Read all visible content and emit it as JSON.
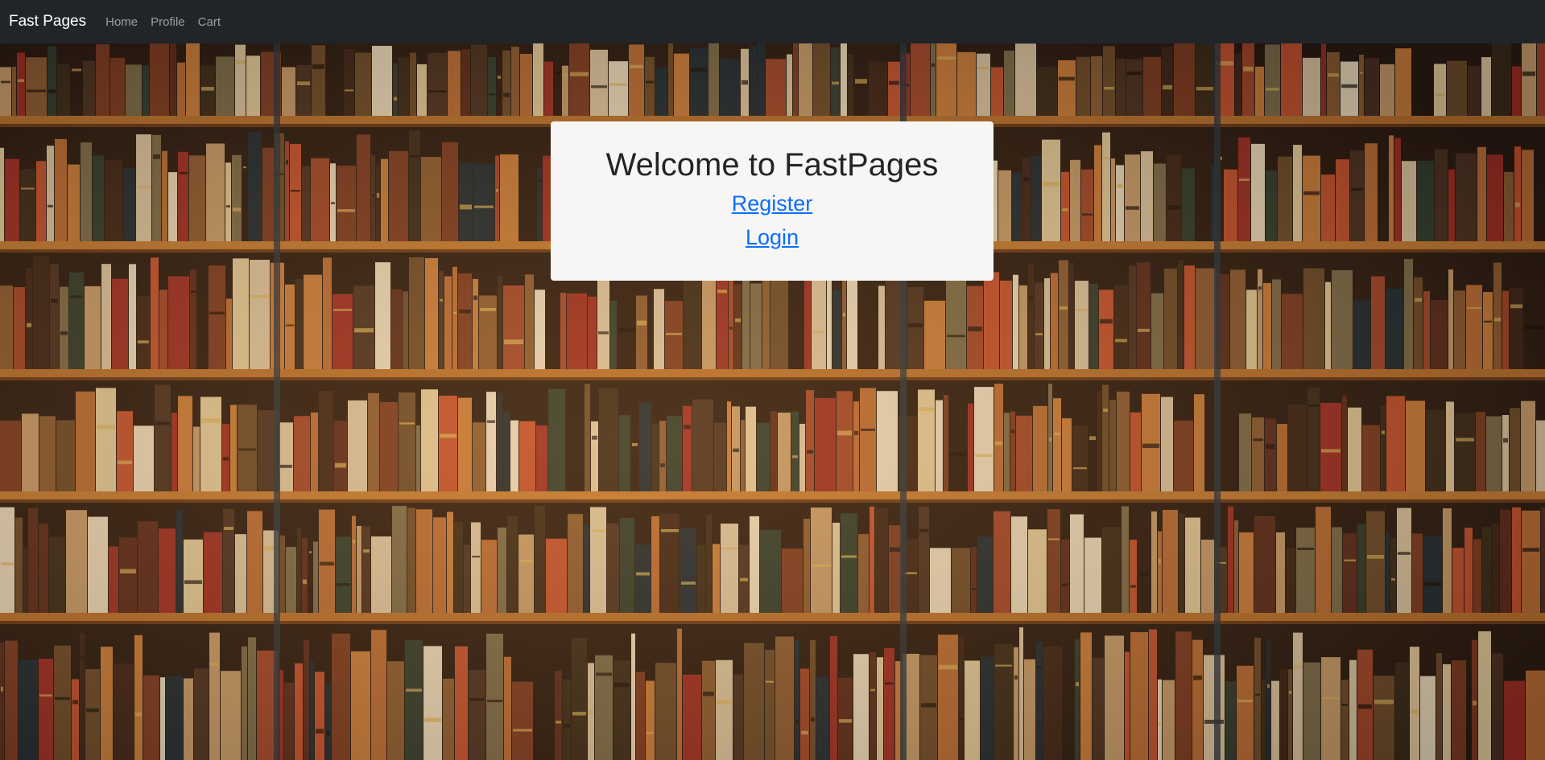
{
  "navbar": {
    "brand": "Fast Pages",
    "links": [
      "Home",
      "Profile",
      "Cart"
    ]
  },
  "background": {
    "description_icon": "bookshelf-background-image"
  },
  "welcome": {
    "title": "Welcome to FastPages",
    "register_label": "Register",
    "login_label": "Login"
  },
  "colors": {
    "navbar_bg": "#212529",
    "link_blue": "#0d6efd",
    "card_bg": "#f8f6f4"
  }
}
